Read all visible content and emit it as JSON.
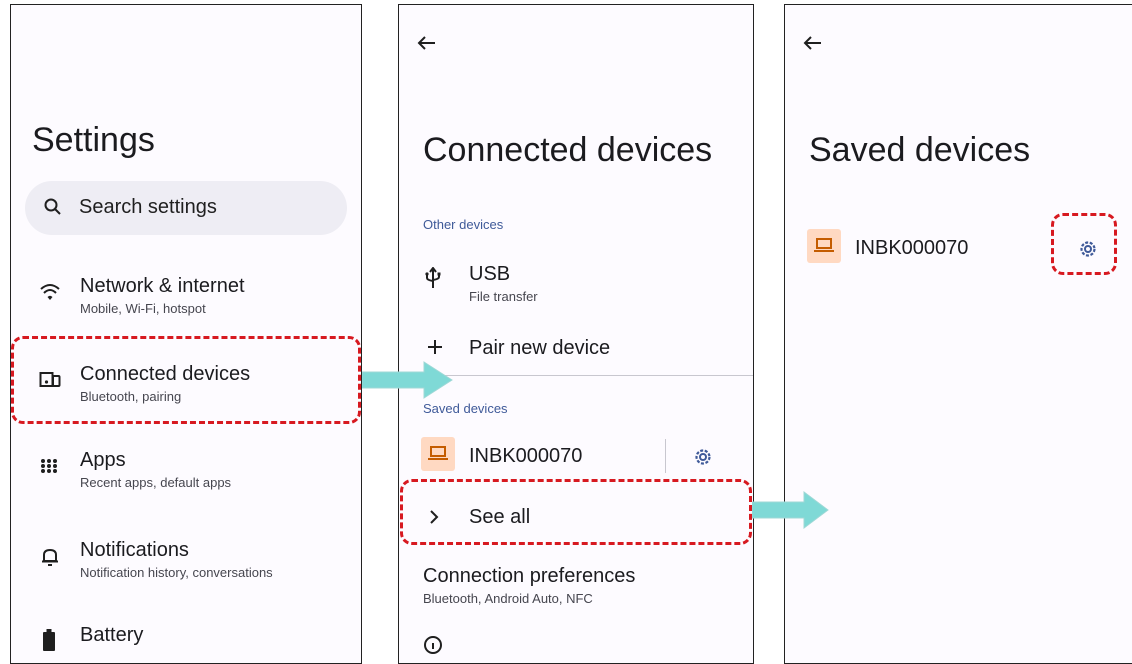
{
  "settings": {
    "title": "Settings",
    "search_placeholder": "Search settings",
    "items": [
      {
        "title": "Network & internet",
        "sub": "Mobile, Wi-Fi, hotspot"
      },
      {
        "title": "Connected devices",
        "sub": "Bluetooth, pairing"
      },
      {
        "title": "Apps",
        "sub": "Recent apps, default apps"
      },
      {
        "title": "Notifications",
        "sub": "Notification history, conversations"
      },
      {
        "title": "Battery",
        "sub": ""
      }
    ]
  },
  "connected": {
    "title": "Connected devices",
    "other_header": "Other devices",
    "usb_title": "USB",
    "usb_sub": "File transfer",
    "pair_label": "Pair new device",
    "saved_header": "Saved devices",
    "device_name": "INBK000070",
    "see_all": "See all",
    "prefs_title": "Connection preferences",
    "prefs_sub": "Bluetooth, Android Auto, NFC"
  },
  "saved": {
    "title": "Saved devices",
    "device_name": "INBK000070"
  },
  "colors": {
    "highlight": "#d71920",
    "arrow": "#7fd9d6",
    "accent": "#3f5a99",
    "device_icon_bg": "#ffd9c2",
    "device_icon": "#c45c00"
  }
}
